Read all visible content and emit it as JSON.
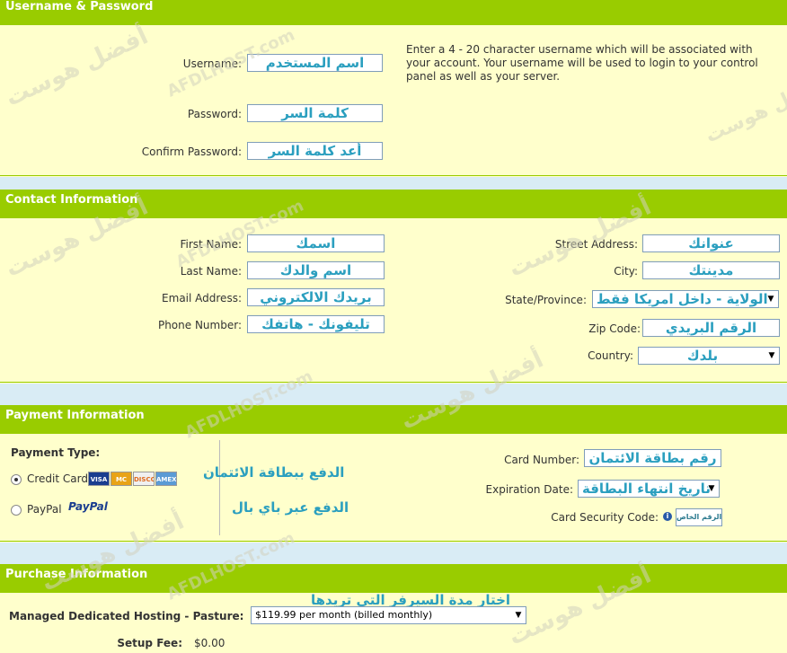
{
  "watermark": {
    "arabic": "أفضل هوست",
    "latin": "AFDLHOST.com"
  },
  "account": {
    "header": "Username & Password",
    "username_label": "Username:",
    "username_value": "اسم المستخدم",
    "password_label": "Password:",
    "password_value": "كلمة السر",
    "confirm_label": "Confirm Password:",
    "confirm_value": "أعد كلمة السر",
    "description": "Enter a 4 - 20 character username which will be associated with your account. Your username will be used to login to your control panel as well as your server."
  },
  "contact": {
    "header": "Contact Information",
    "first_name_label": "First Name:",
    "first_name_value": "اسمك",
    "last_name_label": "Last Name:",
    "last_name_value": "اسم والدك",
    "email_label": "Email Address:",
    "email_value": "بريدك الالكتروني",
    "phone_label": "Phone Number:",
    "phone_value": "تليفونك - هاتفك",
    "street_label": "Street Address:",
    "street_value": "عنوانك",
    "city_label": "City:",
    "city_value": "مدينتك",
    "state_label": "State/Province:",
    "state_value": "الولاية - داخل امريكا فقط",
    "zip_label": "Zip Code:",
    "zip_value": "الرقم البريدي",
    "country_label": "Country:",
    "country_value": "بلدك"
  },
  "payment": {
    "header": "Payment Information",
    "type_label": "Payment Type:",
    "credit_card_label": "Credit Card",
    "paypal_label": "PayPal",
    "paypal_logo": "PayPal",
    "card_logos": [
      "VISA",
      "MC",
      "DISCOVER",
      "AMEX"
    ],
    "credit_annotation": "الدفع ببطاقة الائتمان",
    "paypal_annotation": "الدفع عبر باي بال",
    "card_number_label": "Card Number:",
    "card_number_value": "رقم بطاقة الائتمان",
    "expiration_label": "Expiration Date:",
    "expiration_value": "تاريخ انتهاء البطاقة",
    "security_label": "Card Security Code:",
    "security_value": "الرقم الخاص",
    "info_icon": "i"
  },
  "purchase": {
    "header": "Purchase Information",
    "annotation": "اختار مدة السيرفر التي تريدها",
    "plan_label": "Managed Dedicated Hosting - Pasture:",
    "plan_value": "$119.99 per month (billed monthly)",
    "setup_fee_label": "Setup Fee:",
    "setup_fee_value": "$0.00"
  },
  "colors": {
    "header_green": "#99cc00",
    "panel_yellow": "#ffffcc",
    "annotation_blue": "#2b9fbf",
    "gap_blue": "#d9ecf5"
  }
}
